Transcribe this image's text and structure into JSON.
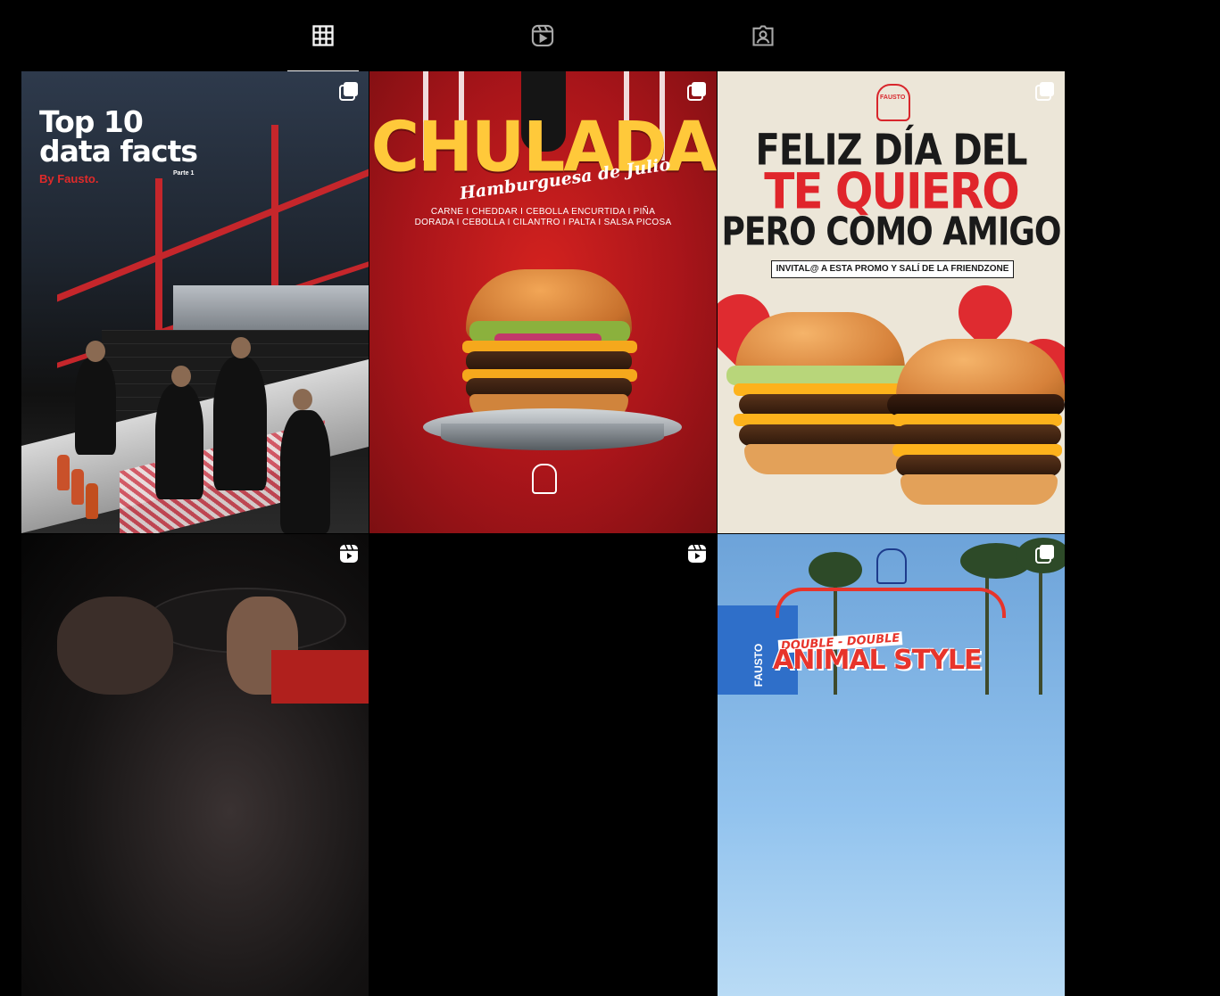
{
  "tabs": [
    {
      "label": "Posts",
      "icon": "grid-icon",
      "active": true
    },
    {
      "label": "Reels",
      "icon": "reels-icon",
      "active": false
    },
    {
      "label": "Tagged",
      "icon": "tagged-icon",
      "active": false
    }
  ],
  "colors": {
    "background": "#000000",
    "tab_active": "#f5f5f5",
    "brand_red": "#d8262c",
    "chulada_yellow": "#ffc93a"
  },
  "posts": [
    {
      "type": "carousel",
      "badge_icon": "carousel-icon",
      "title_line1": "Top 10",
      "title_line2": "data facts",
      "byline": "By Fausto.",
      "part": "Parte 1"
    },
    {
      "type": "carousel",
      "badge_icon": "carousel-icon",
      "title": "CHULADA",
      "subtitle": "Hamburguesa de Julio",
      "ingredients_line1": "CARNE I CHEDDAR I CEBOLLA ENCURTIDA I PIÑA",
      "ingredients_line2": "DORADA I CEBOLLA I CILANTRO I PALTA I SALSA PICOSA"
    },
    {
      "type": "carousel",
      "badge_icon": "carousel-icon",
      "brand": "FAUSTO",
      "line1": "FELIZ DÍA DEL",
      "line2": "TE QUIERO",
      "line3": "PERO COMO AMIGO",
      "banner": "INVITAL@ A ESTA PROMO Y SALÍ DE LA FRIENDZONE"
    },
    {
      "type": "reel",
      "badge_icon": "reel-icon"
    },
    {
      "type": "reel",
      "badge_icon": "reel-icon"
    },
    {
      "type": "carousel",
      "badge_icon": "carousel-icon",
      "line1": "DOUBLE - DOUBLE",
      "line2": "ANIMAL STYLE",
      "storefront": "FAUSTO"
    }
  ]
}
